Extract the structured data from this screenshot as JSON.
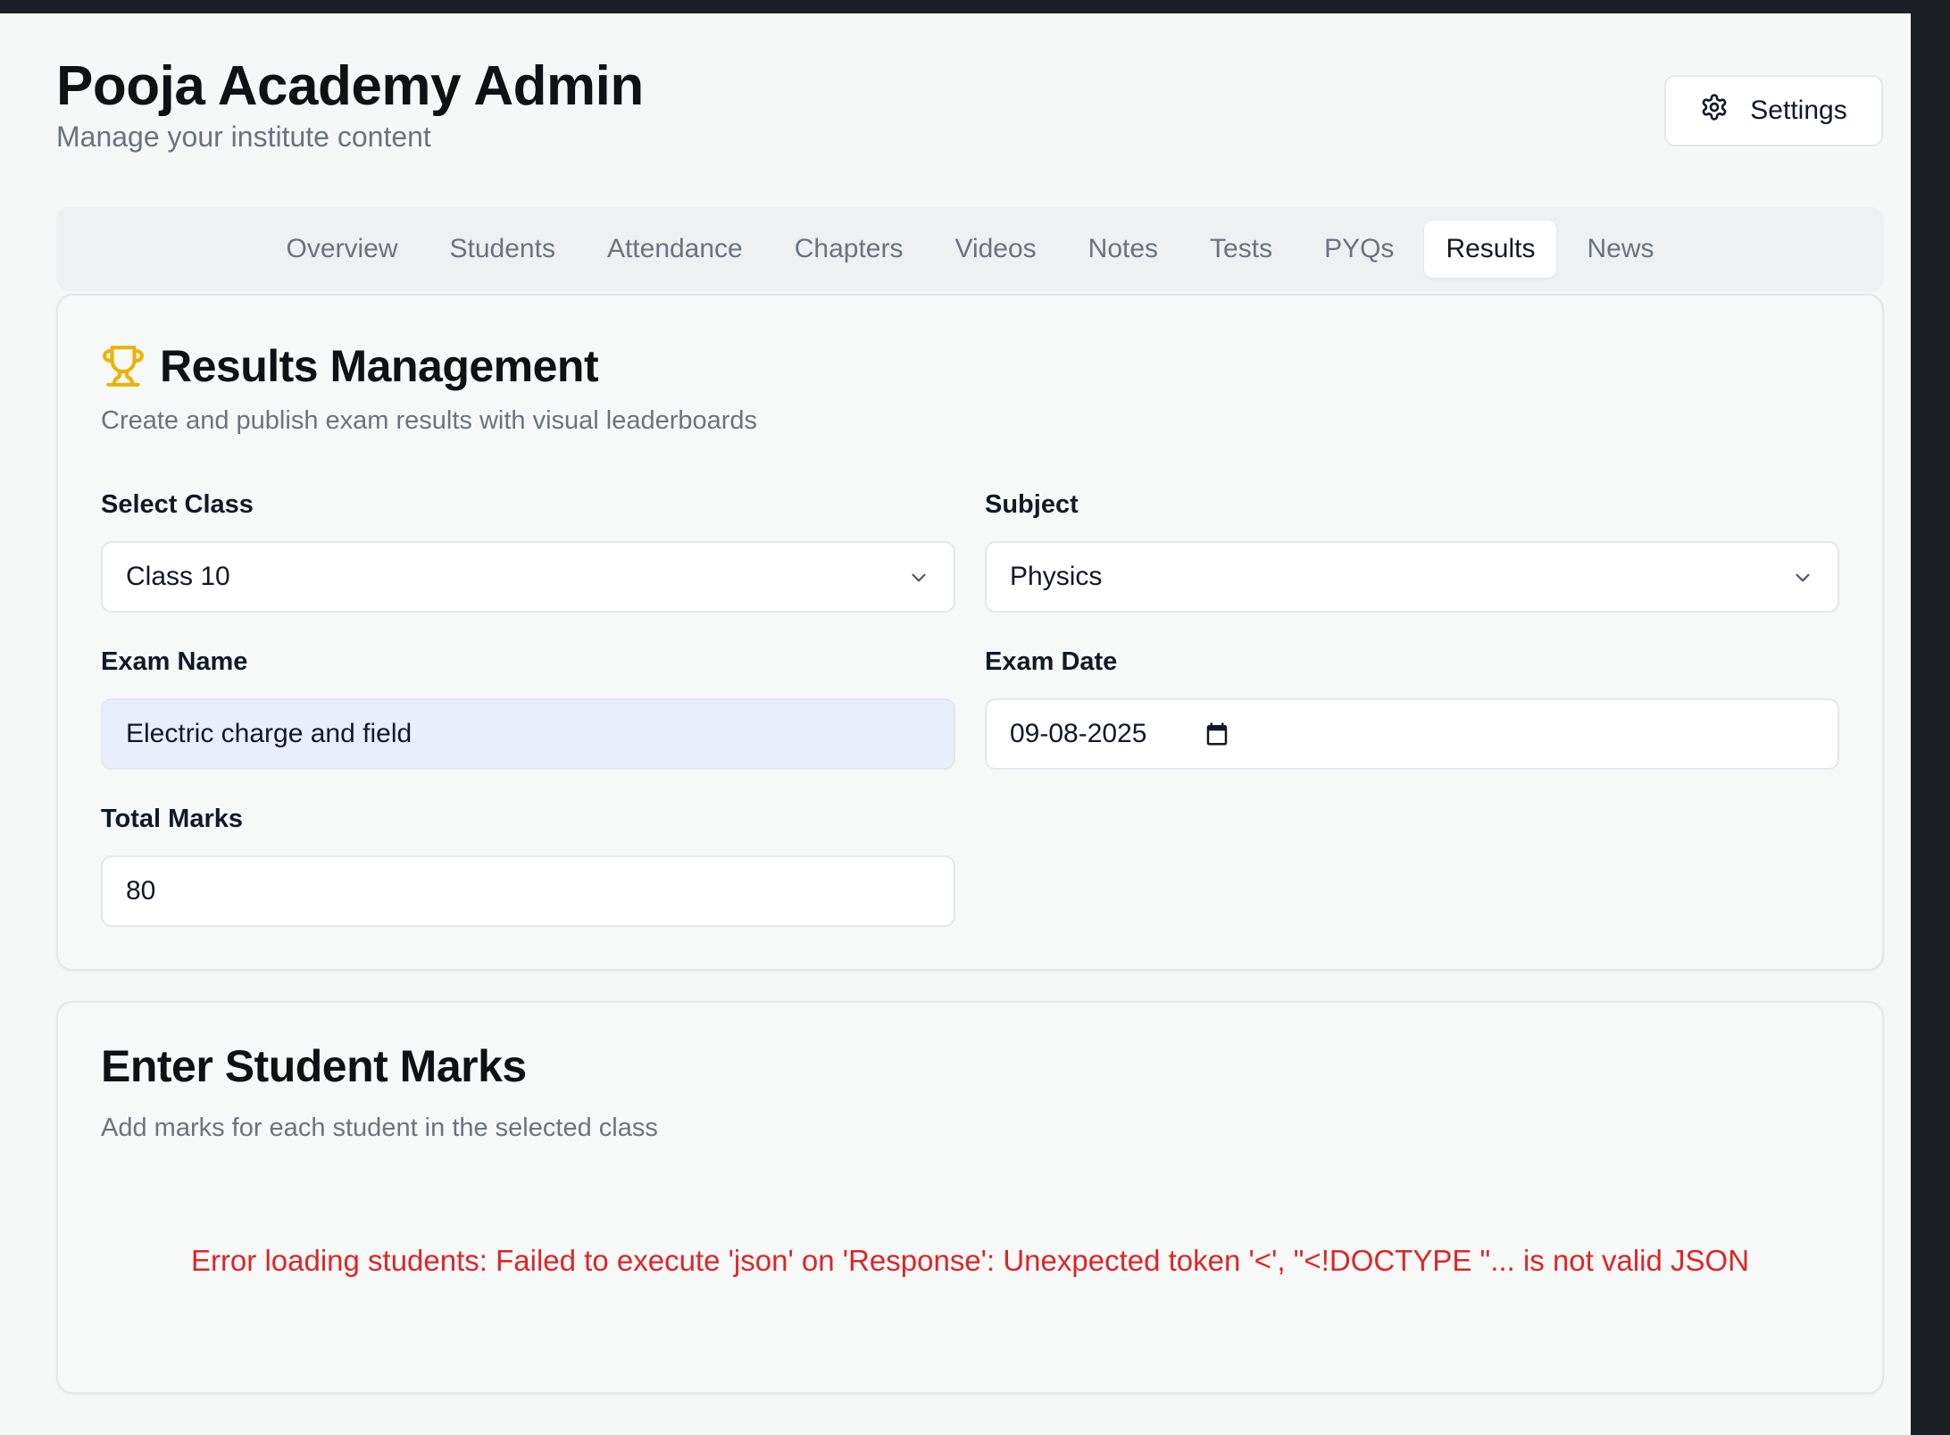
{
  "header": {
    "title": "Pooja Academy Admin",
    "subtitle": "Manage your institute content",
    "settings_label": "Settings"
  },
  "tabs": [
    {
      "label": "Overview",
      "active": false
    },
    {
      "label": "Students",
      "active": false
    },
    {
      "label": "Attendance",
      "active": false
    },
    {
      "label": "Chapters",
      "active": false
    },
    {
      "label": "Videos",
      "active": false
    },
    {
      "label": "Notes",
      "active": false
    },
    {
      "label": "Tests",
      "active": false
    },
    {
      "label": "PYQs",
      "active": false
    },
    {
      "label": "Results",
      "active": true
    },
    {
      "label": "News",
      "active": false
    }
  ],
  "results": {
    "title": "Results Management",
    "description": "Create and publish exam results with visual leaderboards",
    "icon": "trophy-icon",
    "select_class": {
      "label": "Select Class",
      "value": "Class 10"
    },
    "subject": {
      "label": "Subject",
      "value": "Physics"
    },
    "exam_name": {
      "label": "Exam Name",
      "value": "Electric charge and field"
    },
    "exam_date": {
      "label": "Exam Date",
      "value": "09-08-2025"
    },
    "total_marks": {
      "label": "Total Marks",
      "value": "80"
    }
  },
  "marks": {
    "title": "Enter Student Marks",
    "description": "Add marks for each student in the selected class",
    "error": "Error loading students: Failed to execute 'json' on 'Response': Unexpected token '<', \"<!DOCTYPE \"... is not valid JSON"
  },
  "colors": {
    "accent_trophy": "#eab308",
    "error": "#dc2626",
    "filled_input": "#e8effb"
  }
}
